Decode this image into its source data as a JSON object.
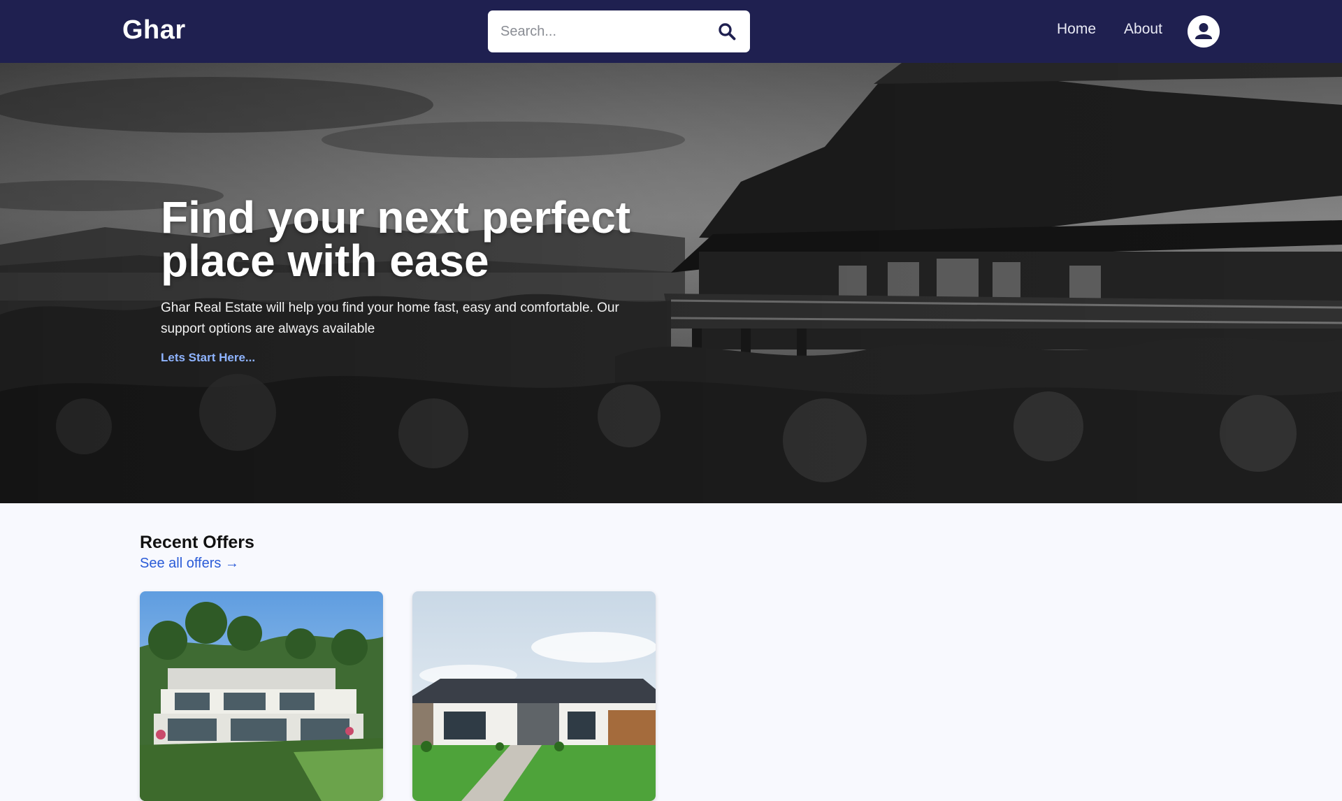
{
  "header": {
    "brand": "Ghar",
    "search": {
      "placeholder": "Search..."
    },
    "nav": [
      {
        "label": "Home"
      },
      {
        "label": "About"
      }
    ]
  },
  "hero": {
    "title": "Find your next perfect place with ease",
    "subtitle": "Ghar Real Estate will help you find your home fast, easy and comfortable. Our support options are always available",
    "cta": "Lets Start Here..."
  },
  "offers": {
    "title": "Recent Offers",
    "link": "See all offers →"
  },
  "colors": {
    "navbar": "#1f2050",
    "link": "#2a5bd7",
    "cta": "#8fb4ff",
    "page_bg": "#f8f9fe"
  },
  "icons": {
    "search": "search-icon",
    "profile": "user-icon"
  }
}
